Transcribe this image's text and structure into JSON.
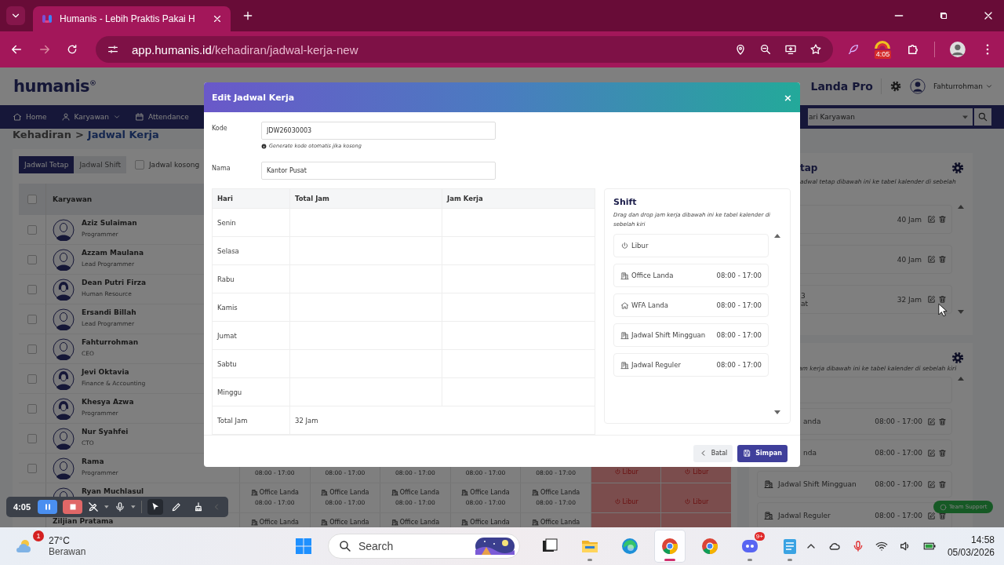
{
  "browser": {
    "tabs": [
      {
        "title": "Humanis - Lebih Praktis Pakai H",
        "selected": true
      }
    ],
    "url_host": "app.humanis.id",
    "url_path": "/kehadiran/jadwal-kerja-new",
    "forward_disabled": true,
    "extension_badge": "4:05"
  },
  "header": {
    "logo": "humanis",
    "logo_mark": "®",
    "company": "Landa Pro",
    "user": "Fahturrohman"
  },
  "nav": {
    "items": [
      {
        "kind": "home",
        "label": "Home",
        "dropdown": false
      },
      {
        "kind": "staff",
        "label": "Karyawan",
        "dropdown": true
      },
      {
        "kind": "attendance",
        "label": "Attendance",
        "dropdown": false
      }
    ],
    "search_placeholder": "ari Karyawan"
  },
  "breadcrumb": {
    "parent": "Kehadiran",
    "separator": ">",
    "current": "Jadwal Kerja"
  },
  "schedule": {
    "tabs": [
      {
        "label": "Jadwal Tetap",
        "selected": true
      },
      {
        "label": "Jadwal Shift",
        "selected": false
      }
    ],
    "empty_filter": {
      "label": "Jadwal kosong",
      "checked": false
    },
    "all_checked": false,
    "column": "Karyawan",
    "rows": [
      {
        "name": "Aziz Sulaiman",
        "role": "Programmer",
        "kind": "male",
        "checked": false
      },
      {
        "name": "Azzam Maulana",
        "role": "Lead Programmer",
        "kind": "male",
        "checked": false
      },
      {
        "name": "Dean Putri Firza",
        "role": "Human Resource",
        "kind": "female",
        "checked": false
      },
      {
        "name": "Ersandi Billah",
        "role": "Lead Programmer",
        "kind": "male",
        "checked": false
      },
      {
        "name": "Fahturrohman",
        "role": "CEO",
        "kind": "male",
        "checked": false
      },
      {
        "name": "Jevi Oktavia",
        "role": "Finance & Accounting",
        "kind": "female",
        "checked": false
      },
      {
        "name": "Khesya Azwa",
        "role": "Programmer",
        "kind": "female",
        "checked": false
      },
      {
        "name": "Nur Syahfei",
        "role": "CTO",
        "kind": "male",
        "checked": false
      },
      {
        "name": "Rama",
        "role": "Programmer",
        "kind": "male",
        "checked": false,
        "cells": [
          {
            "kind": "shift",
            "time": "08:00 - 17:00"
          },
          {
            "kind": "shift",
            "time": "08:00 - 17:00"
          },
          {
            "kind": "shift",
            "time": "08:00 - 17:00"
          },
          {
            "kind": "shift",
            "time": "08:00 - 17:00"
          },
          {
            "kind": "shift",
            "time": "08:00 - 17:00"
          },
          {
            "kind": "off",
            "label": "Libur"
          },
          {
            "kind": "off",
            "label": "Libur"
          }
        ]
      },
      {
        "name": "Ryan Muchlasul",
        "kind": "male",
        "cells": [
          {
            "kind": "shift",
            "name": "Office Landa",
            "time": "08:00 - 17:00"
          },
          {
            "kind": "shift",
            "name": "Office Landa",
            "time": "08:00 - 17:00"
          },
          {
            "kind": "shift",
            "name": "Office Landa",
            "time": "08:00 - 17:00"
          },
          {
            "kind": "shift",
            "name": "Office Landa",
            "time": "08:00 - 17:00"
          },
          {
            "kind": "shift",
            "name": "Office Landa",
            "time": "08:00 - 17:00"
          },
          {
            "kind": "off",
            "label": "Libur"
          },
          {
            "kind": "off",
            "label": "Libur"
          }
        ]
      },
      {
        "name": "Ziljian Pratama",
        "cells": [
          {
            "kind": "shift",
            "name": "Office Landa"
          },
          {
            "kind": "shift",
            "name": "Office Landa"
          },
          {
            "kind": "shift",
            "name": "Office Landa"
          },
          {
            "kind": "shift",
            "name": "Office Landa"
          },
          {
            "kind": "shift",
            "name": "Office Landa"
          },
          {
            "kind": "off"
          },
          {
            "kind": "off"
          }
        ]
      }
    ]
  },
  "fixed_panel": {
    "title": "tap",
    "hint": "adwal tetap dibawah ini ke tabel kalender di sebelah",
    "items": [
      {
        "hours": "40 Jam"
      },
      {
        "hours": "40 Jam"
      },
      {
        "lines": [
          "3",
          "at"
        ],
        "hours": "32 Jam"
      }
    ]
  },
  "shift_panel": {
    "hint": "am kerja dibawah ini ke tabel kalender di sebelah kiri",
    "items": [
      {
        "kind": "clipped"
      },
      {
        "kind": "clipped",
        "label": "anda",
        "time": "08:00 - 17:00"
      },
      {
        "kind": "clipped",
        "label": "nda",
        "time": "08:00 - 17:00"
      },
      {
        "kind": "office",
        "label": "Jadwal Shift Mingguan",
        "time": "08:00 - 17:00"
      },
      {
        "kind": "office",
        "label": "Jadwal Reguler",
        "time": "08:00 - 17:00"
      }
    ]
  },
  "support_button": "Team Support",
  "dialog": {
    "title": "Edit Jadwal Kerja",
    "close": "×",
    "fields": [
      {
        "label": "Kode",
        "value": "JDW26030003",
        "hint": "Generate kode otomatis jika kosong"
      },
      {
        "label": "Nama",
        "value": "Kantor Pusat"
      }
    ],
    "table": {
      "columns": [
        "Hari",
        "Total Jam",
        "Jam Kerja"
      ],
      "days": [
        "Senin",
        "Selasa",
        "Rabu",
        "Kamis",
        "Jumat",
        "Sabtu",
        "Minggu"
      ],
      "total_label": "Total Jam",
      "total_value": "32 Jam"
    },
    "shift": {
      "title": "Shift",
      "hint": "Drag dan drop jam kerja dibawah ini ke tabel kalender di sebelah kiri",
      "items": [
        {
          "kind": "off",
          "label": "Libur"
        },
        {
          "kind": "office",
          "label": "Office Landa",
          "time": "08:00 - 17:00"
        },
        {
          "kind": "remote",
          "label": "WFA Landa",
          "time": "08:00 - 17:00"
        },
        {
          "kind": "office",
          "label": "Jadwal Shift Mingguan",
          "time": "08:00 - 17:00"
        },
        {
          "kind": "office",
          "label": "Jadwal Reguler",
          "time": "08:00 - 17:00"
        }
      ]
    },
    "buttons": [
      {
        "kind": "back",
        "label": "Batal"
      },
      {
        "kind": "save",
        "label": "Simpan"
      }
    ]
  },
  "recorder": {
    "time": "4:05",
    "tools": [
      {
        "kind": "pointer",
        "selected": true
      },
      {
        "kind": "pencil",
        "selected": false
      },
      {
        "kind": "broom",
        "selected": false
      }
    ]
  },
  "taskbar": {
    "weather": {
      "temp": "27°C",
      "text": "Berawan",
      "badge": "1"
    },
    "search": "Search",
    "apps": [
      {
        "kind": "task-view",
        "running": false,
        "active": false
      },
      {
        "kind": "folder",
        "running": true,
        "active": false
      },
      {
        "kind": "swirl",
        "running": false,
        "active": false
      },
      {
        "kind": "browser",
        "running": true,
        "active": true
      },
      {
        "kind": "browser",
        "running": false,
        "active": false
      },
      {
        "kind": "chat",
        "running": true,
        "active": false,
        "badge": "9+"
      },
      {
        "kind": "notepad",
        "running": true,
        "active": false
      }
    ],
    "clock": {
      "time": "14:58",
      "date": "05/03/2026"
    }
  }
}
